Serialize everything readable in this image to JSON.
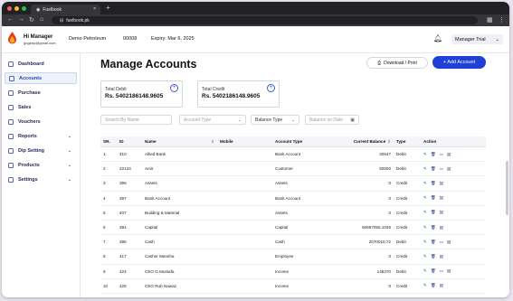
{
  "browser": {
    "tab_title": "Fuelbook",
    "url": "fuelbook.pk"
  },
  "header": {
    "user_title": "Hi Manager",
    "user_email": "gogeep@gmail.com",
    "company": "Demo Petroleum",
    "code": "00008",
    "expiry": "Expiry: Mar 6, 2025",
    "account_menu": "Manager Trial"
  },
  "sidebar": {
    "items": [
      {
        "label": "Dashboard",
        "icon": "dashboard-icon"
      },
      {
        "label": "Accounts",
        "icon": "accounts-icon"
      },
      {
        "label": "Purchase",
        "icon": "cart-icon"
      },
      {
        "label": "Sales",
        "icon": "sales-icon"
      },
      {
        "label": "Vouchers",
        "icon": "voucher-icon"
      },
      {
        "label": "Reports",
        "icon": "reports-icon"
      },
      {
        "label": "Dip Setting",
        "icon": "dip-icon"
      },
      {
        "label": "Products",
        "icon": "products-icon"
      },
      {
        "label": "Settings",
        "icon": "settings-icon"
      }
    ]
  },
  "main": {
    "title": "Manage Accounts",
    "download_label": "Download / Print",
    "add_label": "+ Add Account",
    "total_debit_label": "Total Debit",
    "total_debit_value": "Rs. 5402186148.9605",
    "total_credit_label": "Total Credit",
    "total_credit_value": "Rs. 5402186148.9605",
    "filters": {
      "search_placeholder": "Search By Name",
      "account_type_placeholder": "Account Type",
      "balance_type_value": "Balance Type",
      "date_placeholder": "Balance on Date"
    }
  },
  "table": {
    "headers": {
      "sr": "SR.",
      "id": "ID",
      "name": "Name",
      "mobile": "Mobile",
      "account_type": "Account Type",
      "balance": "Current Balance",
      "type": "Type",
      "action": "Action"
    },
    "rows": [
      {
        "sr": "1",
        "id": "410",
        "name": "Allied Bank",
        "mobile": "",
        "account_type": "Bank Account",
        "balance": "40647",
        "type": "Debit"
      },
      {
        "sr": "2",
        "id": "22134",
        "name": "Amir",
        "mobile": "",
        "account_type": "Customer",
        "balance": "50000",
        "type": "Debit"
      },
      {
        "sr": "3",
        "id": "396",
        "name": "Assets",
        "mobile": "",
        "account_type": "Assets",
        "balance": "0",
        "type": "Credit"
      },
      {
        "sr": "4",
        "id": "397",
        "name": "Bank Account",
        "mobile": "",
        "account_type": "Bank Account",
        "balance": "0",
        "type": "Credit"
      },
      {
        "sr": "5",
        "id": "407",
        "name": "Building & Material",
        "mobile": "",
        "account_type": "Assets",
        "balance": "0",
        "type": "Credit"
      },
      {
        "sr": "6",
        "id": "394",
        "name": "Capital",
        "mobile": "",
        "account_type": "Capital",
        "balance": "60967055.1035",
        "type": "Credit"
      },
      {
        "sr": "7",
        "id": "395",
        "name": "Cash",
        "mobile": "",
        "account_type": "Cash",
        "balance": "2070010.72",
        "type": "Debit"
      },
      {
        "sr": "8",
        "id": "417",
        "name": "Casher Mansha",
        "mobile": "",
        "account_type": "Employee",
        "balance": "0",
        "type": "Credit"
      },
      {
        "sr": "9",
        "id": "424",
        "name": "CEO G.Mustafa",
        "mobile": "",
        "account_type": "Income",
        "balance": "148270",
        "type": "Debit"
      },
      {
        "sr": "10",
        "id": "425",
        "name": "CEO Rub Nawaz",
        "mobile": "",
        "account_type": "Income",
        "balance": "0",
        "type": "Credit"
      },
      {
        "sr": "11",
        "id": "421",
        "name": "Charity",
        "mobile": "",
        "account_type": "Expenses",
        "balance": "4850",
        "type": "Debit"
      }
    ]
  }
}
